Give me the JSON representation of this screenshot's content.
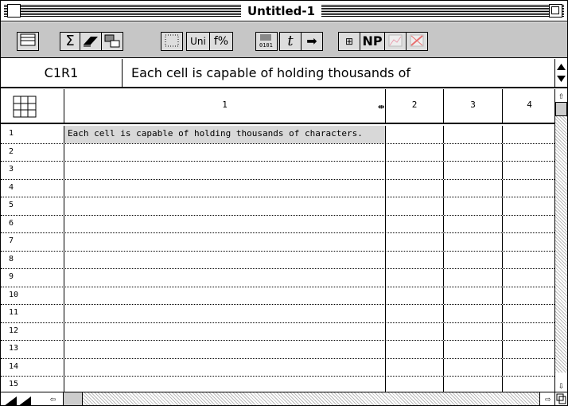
{
  "window": {
    "title": "Untitled-1"
  },
  "toolbar": {
    "buttons": [
      {
        "name": "worksheet-icon",
        "label": ""
      },
      {
        "name": "sum-icon",
        "label": "Σ"
      },
      {
        "name": "eraser-icon",
        "label": ""
      },
      {
        "name": "cell-format-icon",
        "label": ""
      },
      {
        "name": "grid-dots-icon",
        "label": ""
      },
      {
        "name": "unicode-button",
        "label": "Uni"
      },
      {
        "name": "function-button",
        "label": "f%"
      },
      {
        "name": "binary-icon",
        "label": ""
      },
      {
        "name": "text-tool-icon",
        "label": "t"
      },
      {
        "name": "arrow-right-icon",
        "label": "➡"
      },
      {
        "name": "table-icon",
        "label": "⊞"
      },
      {
        "name": "np-button",
        "label": "NP"
      },
      {
        "name": "chart-icon",
        "label": ""
      },
      {
        "name": "no-chart-icon",
        "label": ""
      }
    ]
  },
  "formula_bar": {
    "cell_ref": "C1R1",
    "content": "Each cell is capable of holding thousands of"
  },
  "grid": {
    "columns": [
      "1",
      "2",
      "3",
      "4"
    ],
    "rows": [
      "1",
      "2",
      "3",
      "4",
      "5",
      "6",
      "7",
      "8",
      "9",
      "10",
      "11",
      "12",
      "13",
      "14",
      "15"
    ],
    "cells": {
      "r1c1": "Each cell is capable of holding thousands of characters."
    }
  }
}
